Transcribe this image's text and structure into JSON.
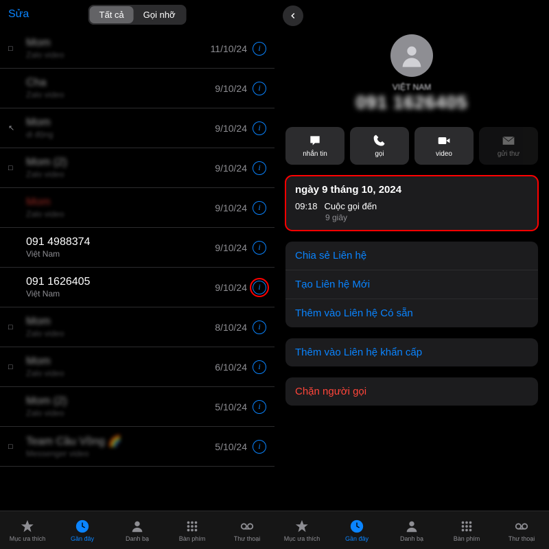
{
  "left": {
    "edit": "Sửa",
    "tabs": {
      "all": "Tất cả",
      "missed": "Gọi nhỡ"
    },
    "calls": [
      {
        "icon": "video",
        "name": "Mom",
        "sub": "Zalo video",
        "date": "11/10/24",
        "missed": false,
        "blur": true
      },
      {
        "icon": "",
        "name": "Cha",
        "sub": "Zalo video",
        "date": "9/10/24",
        "missed": false,
        "blur": true
      },
      {
        "icon": "phone",
        "name": "Mom",
        "sub": "di động",
        "date": "9/10/24",
        "missed": false,
        "blur": true
      },
      {
        "icon": "video",
        "name": "Mom (2)",
        "sub": "Zalo video",
        "date": "9/10/24",
        "missed": false,
        "blur": true
      },
      {
        "icon": "",
        "name": "Mom",
        "sub": "Zalo video",
        "date": "9/10/24",
        "missed": true,
        "blur": true
      },
      {
        "icon": "",
        "name": "091 4988374",
        "sub": "Việt Nam",
        "date": "9/10/24",
        "missed": false,
        "blur": false
      },
      {
        "icon": "",
        "name": "091 1626405",
        "sub": "Việt Nam",
        "date": "9/10/24",
        "missed": false,
        "blur": false,
        "hl": true
      },
      {
        "icon": "video",
        "name": "Mom",
        "sub": "Zalo video",
        "date": "8/10/24",
        "missed": false,
        "blur": true
      },
      {
        "icon": "video",
        "name": "Mom",
        "sub": "Zalo video",
        "date": "6/10/24",
        "missed": false,
        "blur": true
      },
      {
        "icon": "",
        "name": "Mom (2)",
        "sub": "Zalo video",
        "date": "5/10/24",
        "missed": false,
        "blur": true
      },
      {
        "icon": "video",
        "name": "Team Cầu Vồng 🌈",
        "sub": "Messenger video",
        "date": "5/10/24",
        "missed": false,
        "blur": true
      }
    ]
  },
  "right": {
    "country": "VIỆT NAM",
    "phone": "091 1626405",
    "actions": [
      {
        "label": "nhắn tin",
        "icon": "msg"
      },
      {
        "label": "gọi",
        "icon": "call"
      },
      {
        "label": "video",
        "icon": "vid"
      },
      {
        "label": "gửi thư",
        "icon": "mail",
        "disabled": true
      }
    ],
    "log": {
      "date": "ngày 9 tháng 10, 2024",
      "time": "09:18",
      "type": "Cuộc gọi đến",
      "dur": "9 giây"
    },
    "options": [
      {
        "label": "Chia sẻ Liên hệ"
      },
      {
        "label": "Tạo Liên hệ Mới"
      },
      {
        "label": "Thêm vào Liên hệ Có sẵn"
      }
    ],
    "emergency": "Thêm vào Liên hệ khẩn cấp",
    "block": "Chặn người gọi"
  },
  "bottomTabs": [
    {
      "label": "Mục ưa thích",
      "icon": "star"
    },
    {
      "label": "Gần đây",
      "icon": "clock",
      "active": true
    },
    {
      "label": "Danh bạ",
      "icon": "contact"
    },
    {
      "label": "Bàn phím",
      "icon": "keypad"
    },
    {
      "label": "Thư thoại",
      "icon": "vm"
    }
  ]
}
